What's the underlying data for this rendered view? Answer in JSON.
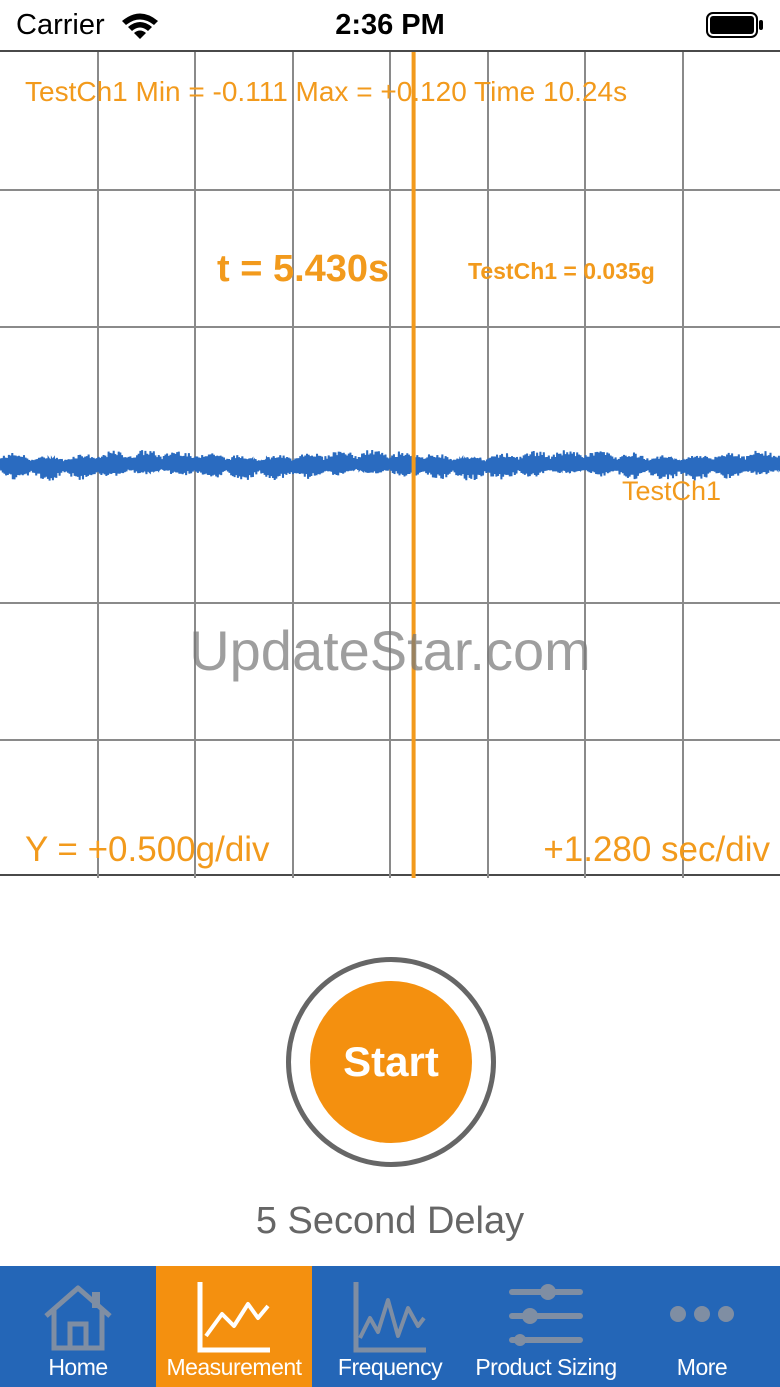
{
  "status_bar": {
    "carrier": "Carrier",
    "time": "2:36 PM"
  },
  "scope": {
    "stats_text": "TestCh1 Min = -0.111 Max = +0.120 Time 10.24s",
    "cursor_time": "t = 5.430s",
    "cursor_value": "TestCh1 = 0.035g",
    "channel_label": "TestCh1",
    "y_scale": "Y = +0.500g/div",
    "x_scale": "+1.280 sec/div",
    "watermark": "UpdateStar.com",
    "colors": {
      "accent": "#f29a1c",
      "trace": "#2a6bc0",
      "grid": "#8a8a8a"
    }
  },
  "chart_data": {
    "type": "line",
    "x_range": [
      0,
      10.24
    ],
    "x_units": "s",
    "y_range": [
      -3,
      3
    ],
    "y_units": "g",
    "x_per_div": 1.28,
    "y_per_div": 0.5,
    "grid": true,
    "series": [
      {
        "name": "TestCh1",
        "min": -0.111,
        "max": 0.12,
        "summary": "low-amplitude vibration signal oscillating around zero"
      }
    ],
    "cursor": {
      "t": 5.43,
      "value": 0.035
    }
  },
  "controls": {
    "start_label": "Start",
    "delay_label": "5 Second Delay",
    "start_color": "#f4900f"
  },
  "tab_bar": {
    "background": "#2466b7",
    "active_background": "#f4900f",
    "items": [
      {
        "label": "Home",
        "icon": "home-icon",
        "active": false
      },
      {
        "label": "Measurement",
        "icon": "line-chart-icon",
        "active": true
      },
      {
        "label": "Frequency",
        "icon": "frequency-chart-icon",
        "active": false
      },
      {
        "label": "Product Sizing",
        "icon": "sliders-icon",
        "active": false
      },
      {
        "label": "More",
        "icon": "more-dots-icon",
        "active": false
      }
    ]
  }
}
